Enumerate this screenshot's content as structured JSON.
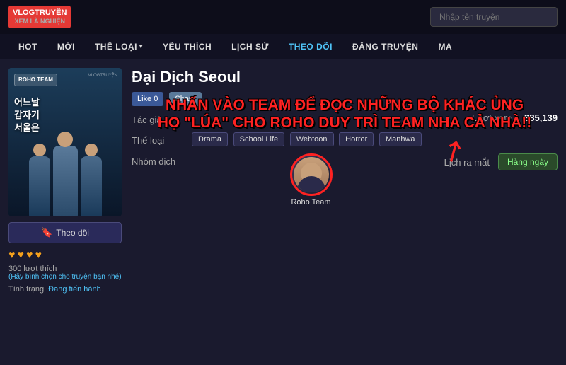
{
  "site": {
    "logo_line1": "VLOGTRUYỆN",
    "logo_line2": "XEM LÀ NGHIỆN",
    "search_placeholder": "Nhập tên truyện"
  },
  "nav": {
    "items": [
      {
        "id": "hot",
        "label": "HOT"
      },
      {
        "id": "moi",
        "label": "MỚI"
      },
      {
        "id": "the-loai",
        "label": "THỂ LOẠI",
        "has_chevron": true
      },
      {
        "id": "yeu-thich",
        "label": "YÊU THÍCH"
      },
      {
        "id": "lich-su",
        "label": "LỊCH SỬ"
      },
      {
        "id": "theo-doi",
        "label": "THEO DÕI"
      },
      {
        "id": "dang-truyen",
        "label": "ĐĂNG TRUYỆN"
      },
      {
        "id": "more",
        "label": "MA"
      }
    ]
  },
  "manga": {
    "title": "Đại Dịch Seoul",
    "cover_korean": "어느날\n갑자기\n서울은",
    "cover_team_badge": "ROHO\nTEAM",
    "cover_watermark": "VLOGTRUYỆN",
    "follow_label": "Theo dõi",
    "hearts": [
      "♥",
      "♥",
      "♥",
      "♥"
    ],
    "likes_count": "300 lượt thích",
    "likes_link": "(Hãy bình chọn cho truyện bạn nhé)",
    "status_label": "Tình trạng",
    "status_value": "Đang tiến hành",
    "overlay_line1": "NHẤN VÀO TEAM ĐỂ ĐỌC NHỮNG BỘ KHÁC ỦNG",
    "overlay_line2": "HỌ \"LÚA\" CHO ROHO DUY TRÌ TEAM NHA CẢ NHÀ!!",
    "author_label": "Tác giả",
    "author_value": "",
    "genre_label": "Thể loại",
    "genres": [
      "Drama",
      "School Life",
      "Webtoon",
      "Horror",
      "Manhwa"
    ],
    "group_label": "Nhóm dịch",
    "group_name": "Roho Team",
    "views_label": "Lượt xem",
    "views_value": "385,139",
    "schedule_label": "Lịch ra mắt",
    "schedule_value": "Hàng ngày",
    "like_btn": "Like 0",
    "share_btn": "Share"
  },
  "icons": {
    "bookmark": "🔖",
    "heart": "♥",
    "arrow": "↗"
  }
}
